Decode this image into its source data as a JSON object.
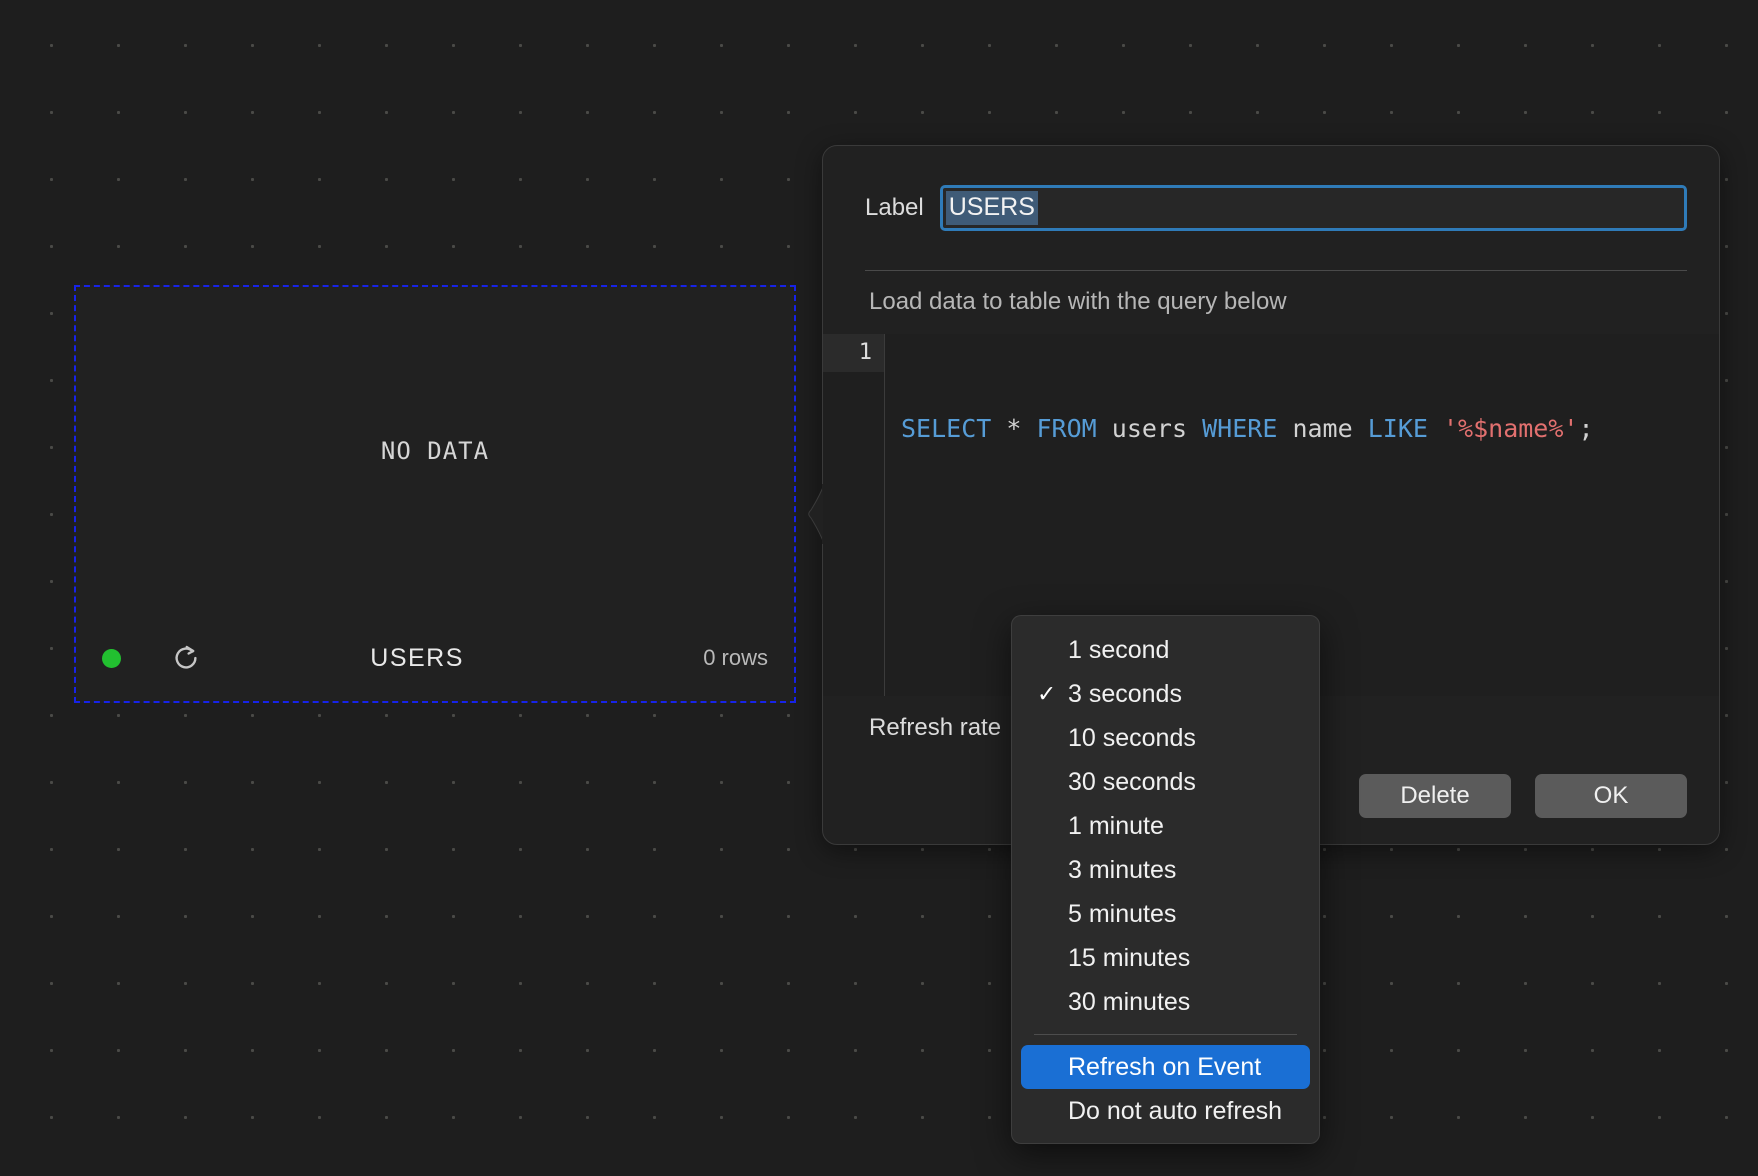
{
  "widget": {
    "name": "table-widget",
    "empty_state_text": "NO DATA",
    "title": "USERS",
    "row_count": "0 rows",
    "status_dot_color": "#22c030",
    "selection_border_color": "#1723e8",
    "refresh_icon": "refresh-icon"
  },
  "panel": {
    "label_caption": "Label",
    "label_value": "USERS",
    "query_caption": "Load data to table with the query below",
    "editor": {
      "line_number": "1",
      "tokens": [
        {
          "text": "SELECT",
          "type": "keyword"
        },
        {
          "text": " ",
          "type": "plain"
        },
        {
          "text": "*",
          "type": "operator"
        },
        {
          "text": " ",
          "type": "plain"
        },
        {
          "text": "FROM",
          "type": "keyword"
        },
        {
          "text": " ",
          "type": "plain"
        },
        {
          "text": "users",
          "type": "identifier"
        },
        {
          "text": " ",
          "type": "plain"
        },
        {
          "text": "WHERE",
          "type": "keyword"
        },
        {
          "text": " ",
          "type": "plain"
        },
        {
          "text": "name",
          "type": "identifier"
        },
        {
          "text": " ",
          "type": "plain"
        },
        {
          "text": "LIKE",
          "type": "keyword"
        },
        {
          "text": " ",
          "type": "plain"
        },
        {
          "text": "'%$name%'",
          "type": "string"
        },
        {
          "text": ";",
          "type": "operator"
        }
      ],
      "full_query": "SELECT * FROM users WHERE name LIKE '%$name%';"
    },
    "refresh_rate_label": "Refresh rate",
    "buttons": {
      "delete_label": "Delete",
      "ok_label": "OK"
    }
  },
  "refresh_menu": {
    "checked_value": "3 seconds",
    "highlighted_value": "Refresh on Event",
    "highlight_color": "#1a6fd4",
    "items": [
      {
        "label": "1 second",
        "checked": false,
        "highlighted": false,
        "separator_after": false
      },
      {
        "label": "3 seconds",
        "checked": true,
        "highlighted": false,
        "separator_after": false
      },
      {
        "label": "10 seconds",
        "checked": false,
        "highlighted": false,
        "separator_after": false
      },
      {
        "label": "30 seconds",
        "checked": false,
        "highlighted": false,
        "separator_after": false
      },
      {
        "label": "1 minute",
        "checked": false,
        "highlighted": false,
        "separator_after": false
      },
      {
        "label": "3 minutes",
        "checked": false,
        "highlighted": false,
        "separator_after": false
      },
      {
        "label": "5 minutes",
        "checked": false,
        "highlighted": false,
        "separator_after": false
      },
      {
        "label": "15 minutes",
        "checked": false,
        "highlighted": false,
        "separator_after": false
      },
      {
        "label": "30 minutes",
        "checked": false,
        "highlighted": false,
        "separator_after": true
      },
      {
        "label": "Refresh on Event",
        "checked": false,
        "highlighted": true,
        "separator_after": false
      },
      {
        "label": "Do not auto refresh",
        "checked": false,
        "highlighted": false,
        "separator_after": false
      }
    ]
  }
}
